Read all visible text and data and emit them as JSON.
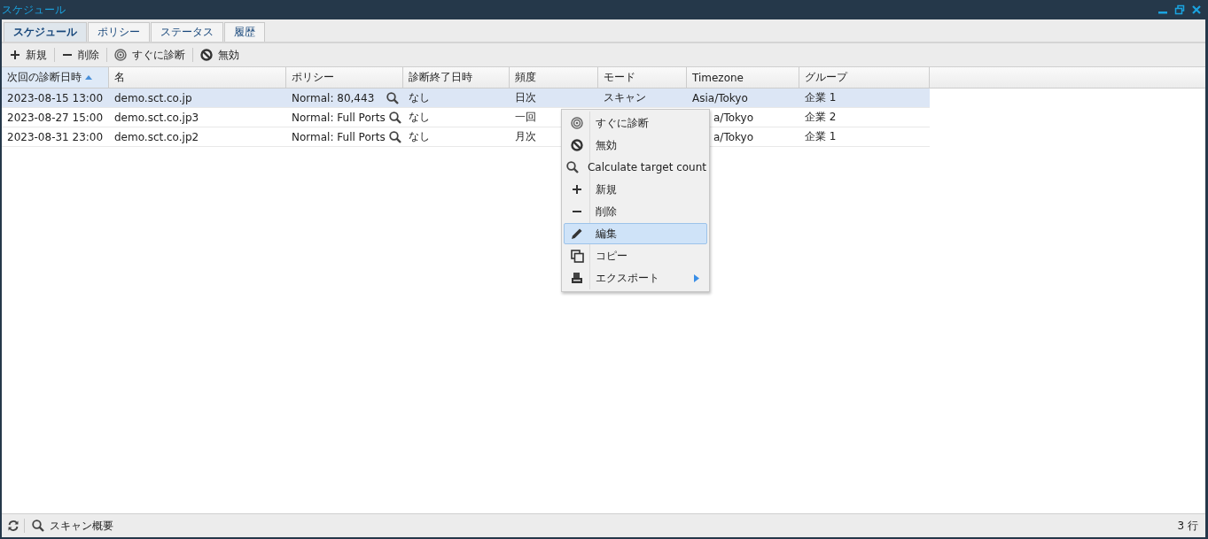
{
  "window": {
    "title": "スケジュール"
  },
  "tabs": [
    {
      "label": "スケジュール",
      "selected": true
    },
    {
      "label": "ポリシー",
      "selected": false
    },
    {
      "label": "ステータス",
      "selected": false
    },
    {
      "label": "履歴",
      "selected": false
    }
  ],
  "toolbar": [
    {
      "label": "新規"
    },
    {
      "label": "削除"
    },
    {
      "label": "すぐに診断"
    },
    {
      "label": "無効"
    }
  ],
  "table": {
    "columns": [
      {
        "label": "次回の診断日時",
        "sorted": true
      },
      {
        "label": "名",
        "sorted": false
      },
      {
        "label": "ポリシー",
        "sorted": false
      },
      {
        "label": "診断終了日時",
        "sorted": false
      },
      {
        "label": "頻度",
        "sorted": false
      },
      {
        "label": "モード",
        "sorted": false
      },
      {
        "label": "Timezone",
        "sorted": false
      },
      {
        "label": "グループ",
        "sorted": false
      }
    ],
    "rows": [
      {
        "selected": true,
        "next": "2023-08-15 13:00",
        "name": "demo.sct.co.jp",
        "policy": "Normal: 80,443",
        "end": "なし",
        "freq": "日次",
        "mode": "スキャン",
        "timezone": "Asia/Tokyo",
        "timezone_covered": false,
        "group": "企業 1"
      },
      {
        "selected": false,
        "next": "2023-08-27 15:00",
        "name": "demo.sct.co.jp3",
        "policy": "Normal: Full Ports",
        "end": "なし",
        "freq": "一回",
        "timezone": "a/Tokyo",
        "timezone_covered": true,
        "group": "企業 2"
      },
      {
        "selected": false,
        "next": "2023-08-31 23:00",
        "name": "demo.sct.co.jp2",
        "policy": "Normal: Full Ports",
        "end": "なし",
        "freq": "月次",
        "timezone": "a/Tokyo",
        "timezone_covered": true,
        "group": "企業 1"
      }
    ]
  },
  "context_menu": [
    {
      "label": "すぐに診断",
      "selected": false,
      "submenu": false
    },
    {
      "label": "無効",
      "selected": false,
      "submenu": false
    },
    {
      "label": "Calculate target count",
      "selected": false,
      "submenu": false
    },
    {
      "label": "新規",
      "selected": false,
      "submenu": false
    },
    {
      "label": "削除",
      "selected": false,
      "submenu": false
    },
    {
      "label": "編集",
      "selected": true,
      "submenu": false
    },
    {
      "label": "コピー",
      "selected": false,
      "submenu": false
    },
    {
      "label": "エクスポート",
      "selected": false,
      "submenu": true
    }
  ],
  "status_bar": {
    "summary": "スキャン概要",
    "row_count": "3 行"
  }
}
